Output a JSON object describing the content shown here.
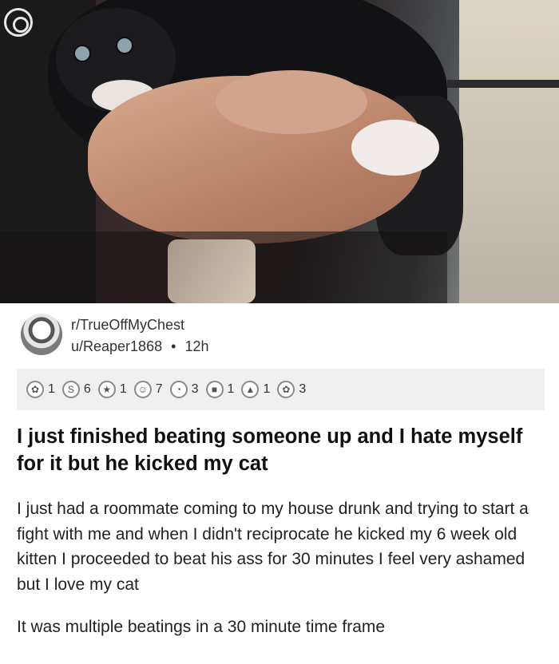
{
  "post": {
    "subreddit": "r/TrueOffMyChest",
    "author": "u/Reaper1868",
    "separator": "•",
    "time": "12h",
    "awards": [
      {
        "icon": "award-icon-1",
        "count": "1"
      },
      {
        "icon": "award-icon-2",
        "glyph": "S",
        "count": "6"
      },
      {
        "icon": "award-icon-3",
        "count": "1"
      },
      {
        "icon": "award-icon-4",
        "count": "7"
      },
      {
        "icon": "award-icon-5",
        "count": "3"
      },
      {
        "icon": "award-icon-6",
        "count": "1"
      },
      {
        "icon": "award-icon-7",
        "count": "1"
      },
      {
        "icon": "award-icon-8",
        "count": "3"
      }
    ],
    "title": "I just finished beating someone up and I hate myself for it but he kicked my cat",
    "body_1": "I just had a roommate coming to my house drunk and trying to start a fight with me and when I didn't reciprocate he kicked my 6 week old kitten I proceeded to beat his ass for 30 minutes I feel very ashamed but I love my cat",
    "body_2": "It was multiple beatings in a 30 minute time frame"
  },
  "icons": {
    "camera": "camera-icon",
    "avatar": "avatar"
  }
}
